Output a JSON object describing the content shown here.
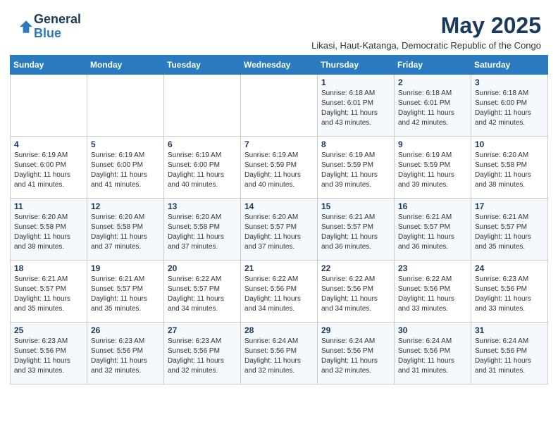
{
  "header": {
    "logo_line1": "General",
    "logo_line2": "Blue",
    "month_year": "May 2025",
    "subtitle": "Likasi, Haut-Katanga, Democratic Republic of the Congo"
  },
  "days_of_week": [
    "Sunday",
    "Monday",
    "Tuesday",
    "Wednesday",
    "Thursday",
    "Friday",
    "Saturday"
  ],
  "weeks": [
    [
      {
        "num": "",
        "info": ""
      },
      {
        "num": "",
        "info": ""
      },
      {
        "num": "",
        "info": ""
      },
      {
        "num": "",
        "info": ""
      },
      {
        "num": "1",
        "info": "Sunrise: 6:18 AM\nSunset: 6:01 PM\nDaylight: 11 hours\nand 43 minutes."
      },
      {
        "num": "2",
        "info": "Sunrise: 6:18 AM\nSunset: 6:01 PM\nDaylight: 11 hours\nand 42 minutes."
      },
      {
        "num": "3",
        "info": "Sunrise: 6:18 AM\nSunset: 6:00 PM\nDaylight: 11 hours\nand 42 minutes."
      }
    ],
    [
      {
        "num": "4",
        "info": "Sunrise: 6:19 AM\nSunset: 6:00 PM\nDaylight: 11 hours\nand 41 minutes."
      },
      {
        "num": "5",
        "info": "Sunrise: 6:19 AM\nSunset: 6:00 PM\nDaylight: 11 hours\nand 41 minutes."
      },
      {
        "num": "6",
        "info": "Sunrise: 6:19 AM\nSunset: 6:00 PM\nDaylight: 11 hours\nand 40 minutes."
      },
      {
        "num": "7",
        "info": "Sunrise: 6:19 AM\nSunset: 5:59 PM\nDaylight: 11 hours\nand 40 minutes."
      },
      {
        "num": "8",
        "info": "Sunrise: 6:19 AM\nSunset: 5:59 PM\nDaylight: 11 hours\nand 39 minutes."
      },
      {
        "num": "9",
        "info": "Sunrise: 6:19 AM\nSunset: 5:59 PM\nDaylight: 11 hours\nand 39 minutes."
      },
      {
        "num": "10",
        "info": "Sunrise: 6:20 AM\nSunset: 5:58 PM\nDaylight: 11 hours\nand 38 minutes."
      }
    ],
    [
      {
        "num": "11",
        "info": "Sunrise: 6:20 AM\nSunset: 5:58 PM\nDaylight: 11 hours\nand 38 minutes."
      },
      {
        "num": "12",
        "info": "Sunrise: 6:20 AM\nSunset: 5:58 PM\nDaylight: 11 hours\nand 37 minutes."
      },
      {
        "num": "13",
        "info": "Sunrise: 6:20 AM\nSunset: 5:58 PM\nDaylight: 11 hours\nand 37 minutes."
      },
      {
        "num": "14",
        "info": "Sunrise: 6:20 AM\nSunset: 5:57 PM\nDaylight: 11 hours\nand 37 minutes."
      },
      {
        "num": "15",
        "info": "Sunrise: 6:21 AM\nSunset: 5:57 PM\nDaylight: 11 hours\nand 36 minutes."
      },
      {
        "num": "16",
        "info": "Sunrise: 6:21 AM\nSunset: 5:57 PM\nDaylight: 11 hours\nand 36 minutes."
      },
      {
        "num": "17",
        "info": "Sunrise: 6:21 AM\nSunset: 5:57 PM\nDaylight: 11 hours\nand 35 minutes."
      }
    ],
    [
      {
        "num": "18",
        "info": "Sunrise: 6:21 AM\nSunset: 5:57 PM\nDaylight: 11 hours\nand 35 minutes."
      },
      {
        "num": "19",
        "info": "Sunrise: 6:21 AM\nSunset: 5:57 PM\nDaylight: 11 hours\nand 35 minutes."
      },
      {
        "num": "20",
        "info": "Sunrise: 6:22 AM\nSunset: 5:57 PM\nDaylight: 11 hours\nand 34 minutes."
      },
      {
        "num": "21",
        "info": "Sunrise: 6:22 AM\nSunset: 5:56 PM\nDaylight: 11 hours\nand 34 minutes."
      },
      {
        "num": "22",
        "info": "Sunrise: 6:22 AM\nSunset: 5:56 PM\nDaylight: 11 hours\nand 34 minutes."
      },
      {
        "num": "23",
        "info": "Sunrise: 6:22 AM\nSunset: 5:56 PM\nDaylight: 11 hours\nand 33 minutes."
      },
      {
        "num": "24",
        "info": "Sunrise: 6:23 AM\nSunset: 5:56 PM\nDaylight: 11 hours\nand 33 minutes."
      }
    ],
    [
      {
        "num": "25",
        "info": "Sunrise: 6:23 AM\nSunset: 5:56 PM\nDaylight: 11 hours\nand 33 minutes."
      },
      {
        "num": "26",
        "info": "Sunrise: 6:23 AM\nSunset: 5:56 PM\nDaylight: 11 hours\nand 32 minutes."
      },
      {
        "num": "27",
        "info": "Sunrise: 6:23 AM\nSunset: 5:56 PM\nDaylight: 11 hours\nand 32 minutes."
      },
      {
        "num": "28",
        "info": "Sunrise: 6:24 AM\nSunset: 5:56 PM\nDaylight: 11 hours\nand 32 minutes."
      },
      {
        "num": "29",
        "info": "Sunrise: 6:24 AM\nSunset: 5:56 PM\nDaylight: 11 hours\nand 32 minutes."
      },
      {
        "num": "30",
        "info": "Sunrise: 6:24 AM\nSunset: 5:56 PM\nDaylight: 11 hours\nand 31 minutes."
      },
      {
        "num": "31",
        "info": "Sunrise: 6:24 AM\nSunset: 5:56 PM\nDaylight: 11 hours\nand 31 minutes."
      }
    ]
  ]
}
